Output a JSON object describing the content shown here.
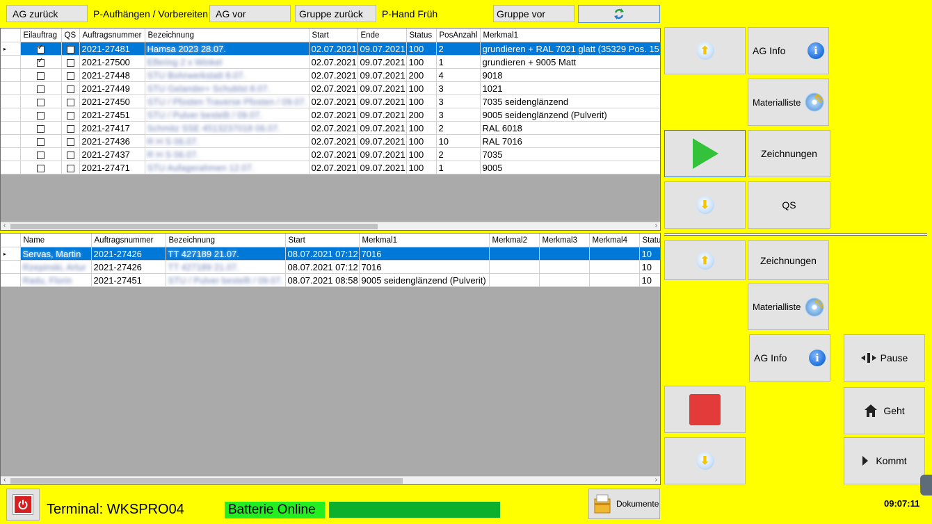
{
  "toolbar": {
    "ag_back": "AG zurück",
    "station": "P-Aufhängen / Vorbereiten",
    "ag_next": "AG vor",
    "group_back": "Gruppe zurück",
    "shift": "P-Hand Früh",
    "group_next": "Gruppe  vor",
    "refresh_icon": "refresh-icon"
  },
  "orders": {
    "columns": [
      "Eilauftrag",
      "QS",
      "Auftragsnummer",
      "Bezeichnung",
      "Start",
      "Ende",
      "Status",
      "PosAnzahl",
      "Merkmal1"
    ],
    "rows": [
      {
        "eil": true,
        "qs": false,
        "nr": "2021-27481",
        "bez": "Hamsa 2023 28.07.",
        "start": "02.07.2021",
        "ende": "09.07.2021",
        "status": "100",
        "pos": "2",
        "m1": "grundieren + RAL 7021 glatt (35329 Pos. 15"
      },
      {
        "eil": true,
        "qs": false,
        "nr": "2021-27500",
        "bez": "Elfering 2 x Winkel",
        "start": "02.07.2021",
        "ende": "09.07.2021",
        "status": "100",
        "pos": "1",
        "m1": "grundieren + 9005 Matt"
      },
      {
        "eil": false,
        "qs": false,
        "nr": "2021-27448",
        "bez": "STU Bohrwerkstatt 8.07.",
        "start": "02.07.2021",
        "ende": "09.07.2021",
        "status": "200",
        "pos": "4",
        "m1": "9018"
      },
      {
        "eil": false,
        "qs": false,
        "nr": "2021-27449",
        "bez": "STU Gelander+ Schublst 8.07.",
        "start": "02.07.2021",
        "ende": "09.07.2021",
        "status": "100",
        "pos": "3",
        "m1": "1021"
      },
      {
        "eil": false,
        "qs": false,
        "nr": "2021-27450",
        "bez": "STU / Pfosten Traverse Pfosten / 09.07.",
        "start": "02.07.2021",
        "ende": "09.07.2021",
        "status": "100",
        "pos": "3",
        "m1": "7035 seidenglänzend"
      },
      {
        "eil": false,
        "qs": false,
        "nr": "2021-27451",
        "bez": "STU / Pulver bestellt / 09.07.",
        "start": "02.07.2021",
        "ende": "09.07.2021",
        "status": "200",
        "pos": "3",
        "m1": "9005 seidenglänzend (Pulverit)"
      },
      {
        "eil": false,
        "qs": false,
        "nr": "2021-27417",
        "bez": "Schmitz SSE 4513237018 06.07.",
        "start": "02.07.2021",
        "ende": "09.07.2021",
        "status": "100",
        "pos": "2",
        "m1": " RAL 6018"
      },
      {
        "eil": false,
        "qs": false,
        "nr": "2021-27436",
        "bez": "R H S 06.07.",
        "start": "02.07.2021",
        "ende": "09.07.2021",
        "status": "100",
        "pos": "10",
        "m1": "RAL 7016"
      },
      {
        "eil": false,
        "qs": false,
        "nr": "2021-27437",
        "bez": "R H S 06.07.",
        "start": "02.07.2021",
        "ende": "09.07.2021",
        "status": "100",
        "pos": "2",
        "m1": "7035"
      },
      {
        "eil": false,
        "qs": false,
        "nr": "2021-27471",
        "bez": "STU Aufagerahmen 12.07.",
        "start": "02.07.2021",
        "ende": "09.07.2021",
        "status": "100",
        "pos": "1",
        "m1": "9005"
      }
    ]
  },
  "active": {
    "columns": [
      "Name",
      "Auftragsnummer",
      "Bezeichnung",
      "Start",
      "Merkmal1",
      "Merkmal2",
      "Merkmal3",
      "Merkmal4",
      "Statu"
    ],
    "rows": [
      {
        "name": "Servas, Martin",
        "nr": "2021-27426",
        "bez": "TT 427189 21.07.",
        "start": "08.07.2021 07:12",
        "m1": "7016",
        "status": "10"
      },
      {
        "name": "Rzepinski, Artur",
        "nr": "2021-27426",
        "bez": "TT 427189 21.07.",
        "start": "08.07.2021 07:12",
        "m1": "7016",
        "status": "10"
      },
      {
        "name": "Radu, Florin",
        "nr": "2021-27451",
        "bez": "STU / Pulver bestellt / 09.07.",
        "start": "08.07.2021 08:58",
        "m1": "9005 seidenglänzend (Pulverit)",
        "status": "10"
      }
    ]
  },
  "side": {
    "ag_info": "AG Info",
    "materialliste": "Materialliste",
    "zeichnungen": "Zeichnungen",
    "qs": "QS",
    "zeichnungen2": "Zeichnungen",
    "materialliste2": "Materialliste",
    "ag_info2": "AG Info",
    "pause": "Pause",
    "geht": "Geht",
    "kommt": "Kommt"
  },
  "footer": {
    "terminal": "Terminal: WKSPRO04",
    "battery": "Batterie Online",
    "documents": "Dokumente",
    "time": "09:07:11"
  },
  "colors": {
    "background": "#ffff00",
    "selection": "#0078d7",
    "battery_bar": "#0cb02c",
    "battery_label": "#22ee22",
    "play": "#34c23a",
    "stop": "#e33a3a"
  }
}
